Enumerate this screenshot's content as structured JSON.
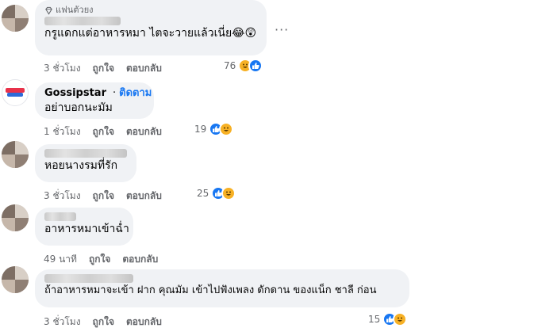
{
  "comments": [
    {
      "badge": "แฟนตัวยง",
      "text": "กรูแดกแต่อาหารหมา ไตจะวายแล้วเนี่ย😂😲",
      "time": "3 ชั่วโมง",
      "like": "ถูกใจ",
      "reply": "ตอบกลับ",
      "reaction_count": "76",
      "reactions": [
        "haha-icon",
        "like-icon"
      ]
    },
    {
      "name": "Gossipstar",
      "follow": "ติดตาม",
      "text": "อย่าบอกนะมัม",
      "time": "1 ชั่วโมง",
      "like": "ถูกใจ",
      "reply": "ตอบกลับ",
      "reaction_count": "19",
      "reactions": [
        "like-icon",
        "haha-icon"
      ]
    },
    {
      "text": "หอยนางรมที่รัก",
      "time": "3 ชั่วโมง",
      "like": "ถูกใจ",
      "reply": "ตอบกลับ",
      "reaction_count": "25",
      "reactions": [
        "like-icon",
        "haha-icon"
      ]
    },
    {
      "text": "อาหารหมาเข้าฉ่ำ",
      "time": "49 นาที",
      "like": "ถูกใจ",
      "reply": "ตอบกลับ"
    },
    {
      "text": "ถ้าอาหารหมาจะเข้า ฝาก คุณมัม เข้าไปฟังเพลง ดักดาน ของแน็ก ชาลี ก่อน",
      "time": "3 ชั่วโมง",
      "like": "ถูกใจ",
      "reply": "ตอบกลับ",
      "reaction_count": "15",
      "reactions": [
        "like-icon",
        "haha-icon"
      ]
    }
  ],
  "colors": {
    "bubble": "#f0f2f5",
    "link": "#1877f2",
    "meta": "#65676b",
    "like": "#1877f2",
    "haha": "#f7b125"
  }
}
